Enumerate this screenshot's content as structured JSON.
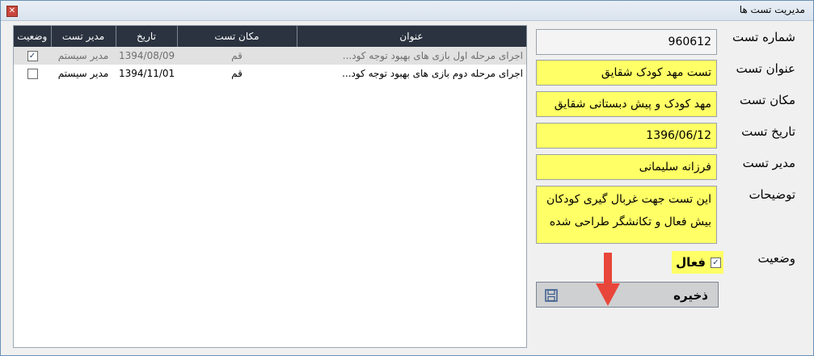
{
  "window": {
    "title": "مدیریت تست ها",
    "close_glyph": "✕"
  },
  "grid": {
    "columns": [
      "وضعیت",
      "مدیر تست",
      "تاریخ",
      "مکان تست",
      "عنوان"
    ],
    "rows": [
      {
        "status_checked": true,
        "manager": "مدیر سیستم",
        "date": "1394/08/09",
        "location": "قم",
        "title": "اجرای مرحله اول بازی های بهبود توجه کود..."
      },
      {
        "status_checked": false,
        "manager": "مدیر سیستم",
        "date": "1394/11/01",
        "location": "قم",
        "title": "اجرای مرحله دوم بازی های بهبود توجه کود..."
      }
    ]
  },
  "form": {
    "labels": {
      "number": "شماره تست",
      "title": "عنوان تست",
      "location": "مکان تست",
      "date": "تاریخ تست",
      "manager": "مدیر تست",
      "description": "توضیحات",
      "status": "وضعیت"
    },
    "values": {
      "number": "960612",
      "title": "تست مهد کودک شقایق",
      "location": "مهد کودک و پیش دبستانی شقایق",
      "date": "1396/06/12",
      "manager": "فرزانه سلیمانی",
      "description_line1": "این تست جهت غربال گیری کودکان",
      "description_line2": "بیش فعال و تکانشگر طراحی شده"
    },
    "active": {
      "label": "فعال",
      "checked": true
    },
    "save_label": "ذخیره"
  },
  "colors": {
    "highlight": "#ffff66",
    "grid_header": "#2b3340",
    "arrow": "#e8463a"
  },
  "icons": {
    "save": "save-icon",
    "close": "close-icon",
    "arrow": "arrow-down-icon"
  }
}
